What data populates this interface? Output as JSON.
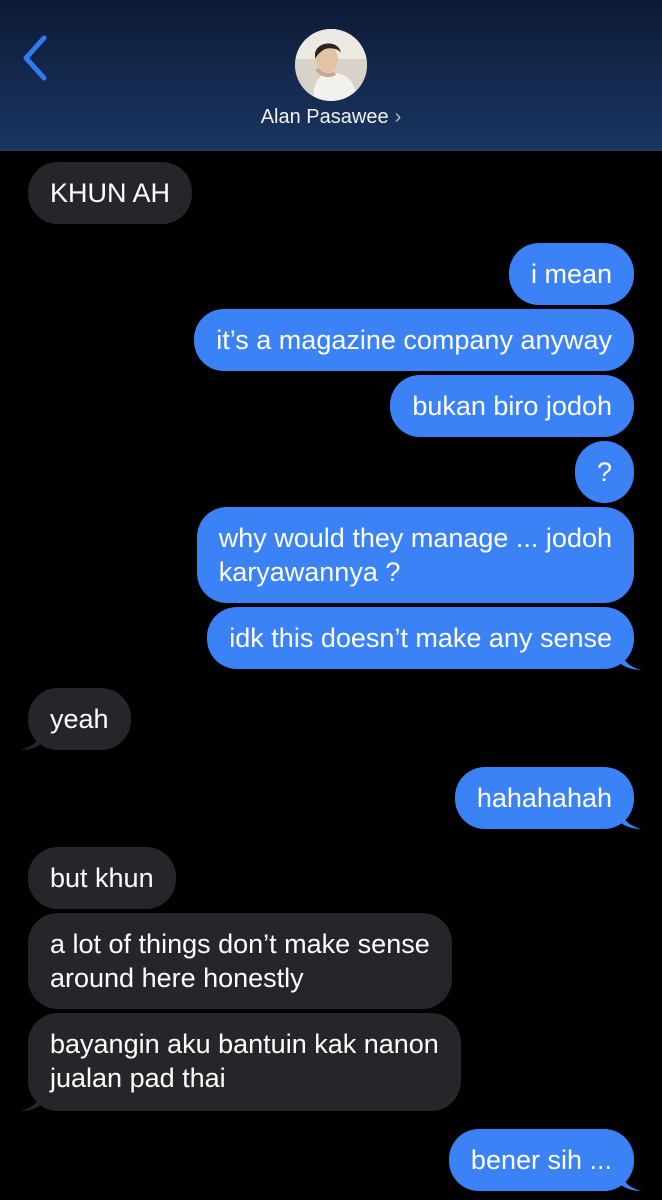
{
  "header": {
    "back_icon": "chevron-left-icon",
    "contact_name": "Alan Pasawee",
    "chevron": "›",
    "accent_color": "#2f7bf6"
  },
  "messages": [
    {
      "from": "contact",
      "text": "KHUN AH"
    },
    {
      "from": "me",
      "text": "i mean"
    },
    {
      "from": "me",
      "text": "it’s a magazine company anyway"
    },
    {
      "from": "me",
      "text": "bukan biro jodoh"
    },
    {
      "from": "me",
      "text": "?"
    },
    {
      "from": "me",
      "text": "why would they manage ... jodoh",
      "text2": "karyawannya ?"
    },
    {
      "from": "me",
      "text": "idk this doesn’t make any sense"
    },
    {
      "from": "contact",
      "text": "yeah"
    },
    {
      "from": "me",
      "text": "hahahahah"
    },
    {
      "from": "contact",
      "text": "but khun"
    },
    {
      "from": "contact",
      "text": "a lot of things don’t make sense",
      "text2": "around here honestly"
    },
    {
      "from": "contact",
      "text": "bayangin aku bantuin kak nanon",
      "text2": "jualan pad thai"
    },
    {
      "from": "me",
      "text": "bener sih ..."
    }
  ],
  "colors": {
    "outgoing_bubble": "#3b82f6",
    "incoming_bubble": "#26262a",
    "background": "#000000"
  }
}
